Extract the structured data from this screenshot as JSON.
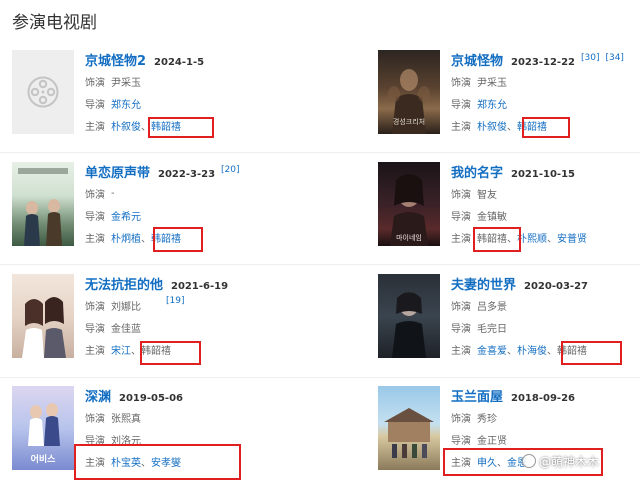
{
  "section_title": "参演电视剧",
  "labels": {
    "role": "饰演",
    "director": "导演",
    "cast": "主演"
  },
  "dramas": [
    {
      "title": "京城怪物2",
      "date": "2024-1-5",
      "refs": [],
      "role": "尹采玉",
      "role_link": false,
      "director": "郑东允",
      "cast": [
        "朴叙俊",
        "韩韶禧"
      ],
      "poster": "placeholder"
    },
    {
      "title": "京城怪物",
      "date": "2023-12-22",
      "refs": [
        "[30]",
        "[34]"
      ],
      "role": "尹采玉",
      "role_link": false,
      "director": "郑东允",
      "cast": [
        "朴叙俊",
        "韩韶禧"
      ],
      "poster": "dark-warm",
      "poster_text": "경성크리처"
    },
    {
      "title": "单恋原声带",
      "date": "2022-3-23",
      "refs": [
        "[20]"
      ],
      "role": "-",
      "role_link": false,
      "director": "金希元",
      "cast": [
        "朴炯植",
        "韩韶禧"
      ],
      "poster": "light-green"
    },
    {
      "title": "我的名字",
      "date": "2021-10-15",
      "refs": [],
      "role": "智友",
      "role_link": false,
      "director": "金镇敏",
      "cast": [
        "韩韶禧",
        "朴熙顺",
        "安普贤"
      ],
      "poster": "dark-red",
      "poster_text": "마이네임"
    },
    {
      "title": "无法抗拒的他",
      "date": "2021-6-19",
      "refs": [
        "[19]"
      ],
      "role": "刘娜比",
      "role_link": false,
      "director": "金佳蓝",
      "cast": [
        "宋江",
        "韩韶禧"
      ],
      "poster": "beige"
    },
    {
      "title": "夫妻的世界",
      "date": "2020-03-27",
      "refs": [],
      "role": "吕多景",
      "role_link": false,
      "director": "毛完日",
      "cast": [
        "金喜爱",
        "朴海俊",
        "韩韶禧"
      ],
      "poster": "dark-blue"
    },
    {
      "title": "深渊",
      "date": "2019-05-06",
      "refs": [],
      "role": "张熙真",
      "role_link": false,
      "director": "刘洛元",
      "cast": [
        "朴宝英",
        "安孝燮"
      ],
      "poster": "light-blue",
      "poster_text": "어비스"
    },
    {
      "title": "玉兰面屋",
      "date": "2018-09-26",
      "refs": [],
      "role": "秀珍",
      "role_link": false,
      "director": "金正贤",
      "cast": [
        "申久",
        "金恩"
      ],
      "poster": "sky"
    }
  ],
  "watermark": "@萌神木木"
}
